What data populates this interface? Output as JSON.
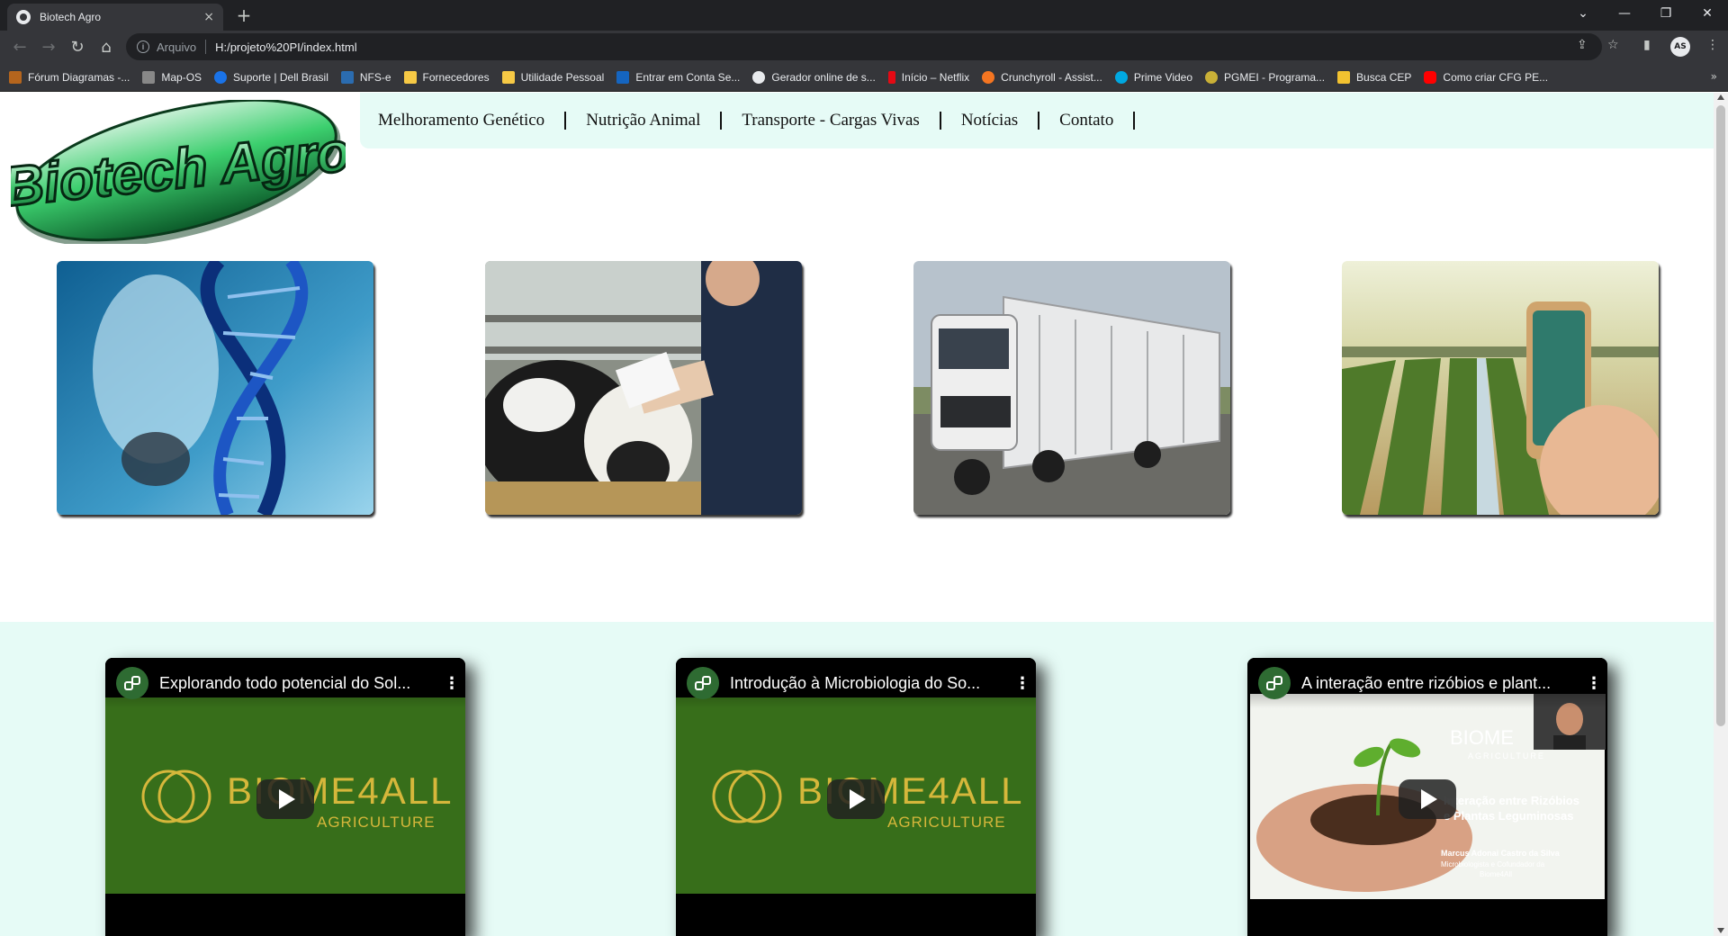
{
  "browser": {
    "tab_title": "Biotech Agro",
    "tab_close": "×",
    "new_tab": "+",
    "address_scheme": "Arquivo",
    "address_url": "H:/projeto%20PI/index.html",
    "profile_initials": "AS",
    "window_controls": [
      "⌄",
      "—",
      "❐",
      "✕"
    ]
  },
  "bookmarks": [
    {
      "label": "Fórum Diagramas -...",
      "color": "#b5651d"
    },
    {
      "label": "Map-OS",
      "color": "#888888"
    },
    {
      "label": "Suporte | Dell Brasil",
      "color": "#1a73e8"
    },
    {
      "label": "NFS-e",
      "color": "#2b6cb0"
    },
    {
      "label": "Fornecedores",
      "color": "#f6c945"
    },
    {
      "label": "Utilidade Pessoal",
      "color": "#f6c945"
    },
    {
      "label": "Entrar em Conta Se...",
      "color": "#1565c0"
    },
    {
      "label": "Gerador online de s...",
      "color": "#e8eaed"
    },
    {
      "label": "Início – Netflix",
      "color": "#e50914"
    },
    {
      "label": "Crunchyroll - Assist...",
      "color": "#f47521"
    },
    {
      "label": "Prime Video",
      "color": "#00a8e1"
    },
    {
      "label": "PGMEI - Programa...",
      "color": "#c9b037"
    },
    {
      "label": "Busca CEP",
      "color": "#f2c230"
    },
    {
      "label": "Como criar CFG PE...",
      "color": "#ff0000"
    }
  ],
  "bookmarks_more": "»",
  "site": {
    "logo_text": "Biotech Agro",
    "menu": [
      "Melhoramento Genético",
      "Nutrição Animal",
      "Transporte - Cargas Vivas",
      "Notícias",
      "Contato"
    ],
    "cards": [
      {
        "topic": "dna-cattle"
      },
      {
        "topic": "animal-nutrition"
      },
      {
        "topic": "livestock-truck"
      },
      {
        "topic": "smart-farm"
      }
    ],
    "videos": [
      {
        "title": "Explorando todo potencial do Sol...",
        "brand": "BIOME4ALL",
        "sub": "AGRICULTURE"
      },
      {
        "title": "Introdução à Microbiologia do So...",
        "brand": "BIOME4ALL",
        "sub": "AGRICULTURE"
      },
      {
        "title": "A interação entre rizóbios e plant...",
        "brand": "BIOME",
        "sub": "AGRICULTURE",
        "overlay_title_1": "Interação entre Rizóbios",
        "overlay_title_2": "e Plantas Leguminosas",
        "presenter": "Marcus Adonai Castro da Silva",
        "presenter_role": "Microbiologista e Cofundador da",
        "presenter_org": "Biome4All"
      }
    ]
  },
  "colors": {
    "menu_bg": "#e6fbf6",
    "video_band_bg": "#e6fbf6",
    "logo_green": "#1f9d4a"
  }
}
